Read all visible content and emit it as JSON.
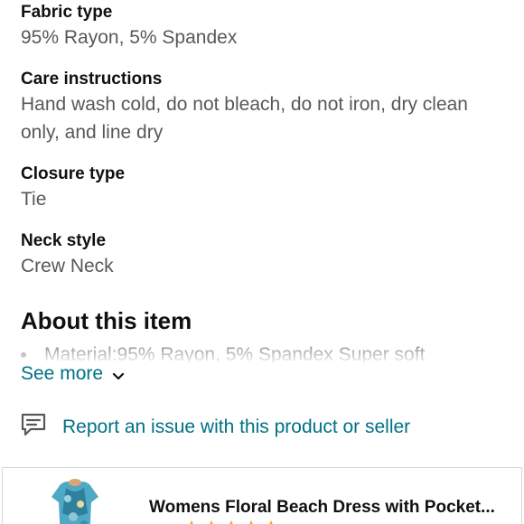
{
  "details": [
    {
      "label": "Fabric type",
      "value": "95% Rayon, 5% Spandex"
    },
    {
      "label": "Care instructions",
      "value": "Hand wash cold, do not bleach, do not iron, dry clean only, and line dry"
    },
    {
      "label": "Closure type",
      "value": "Tie"
    },
    {
      "label": "Neck style",
      "value": "Crew Neck"
    }
  ],
  "about": {
    "heading": "About this item",
    "first_bullet": "Material:95% Rayon, 5% Spandex Super soft",
    "see_more_label": "See more"
  },
  "report": {
    "label": "Report an issue with this product or seller"
  },
  "product_card": {
    "title": "Womens Floral Beach Dress with Pocket..."
  },
  "colors": {
    "link": "#007185",
    "text_primary": "#0f1111",
    "text_secondary": "#565959",
    "star": "#ffa41c"
  }
}
